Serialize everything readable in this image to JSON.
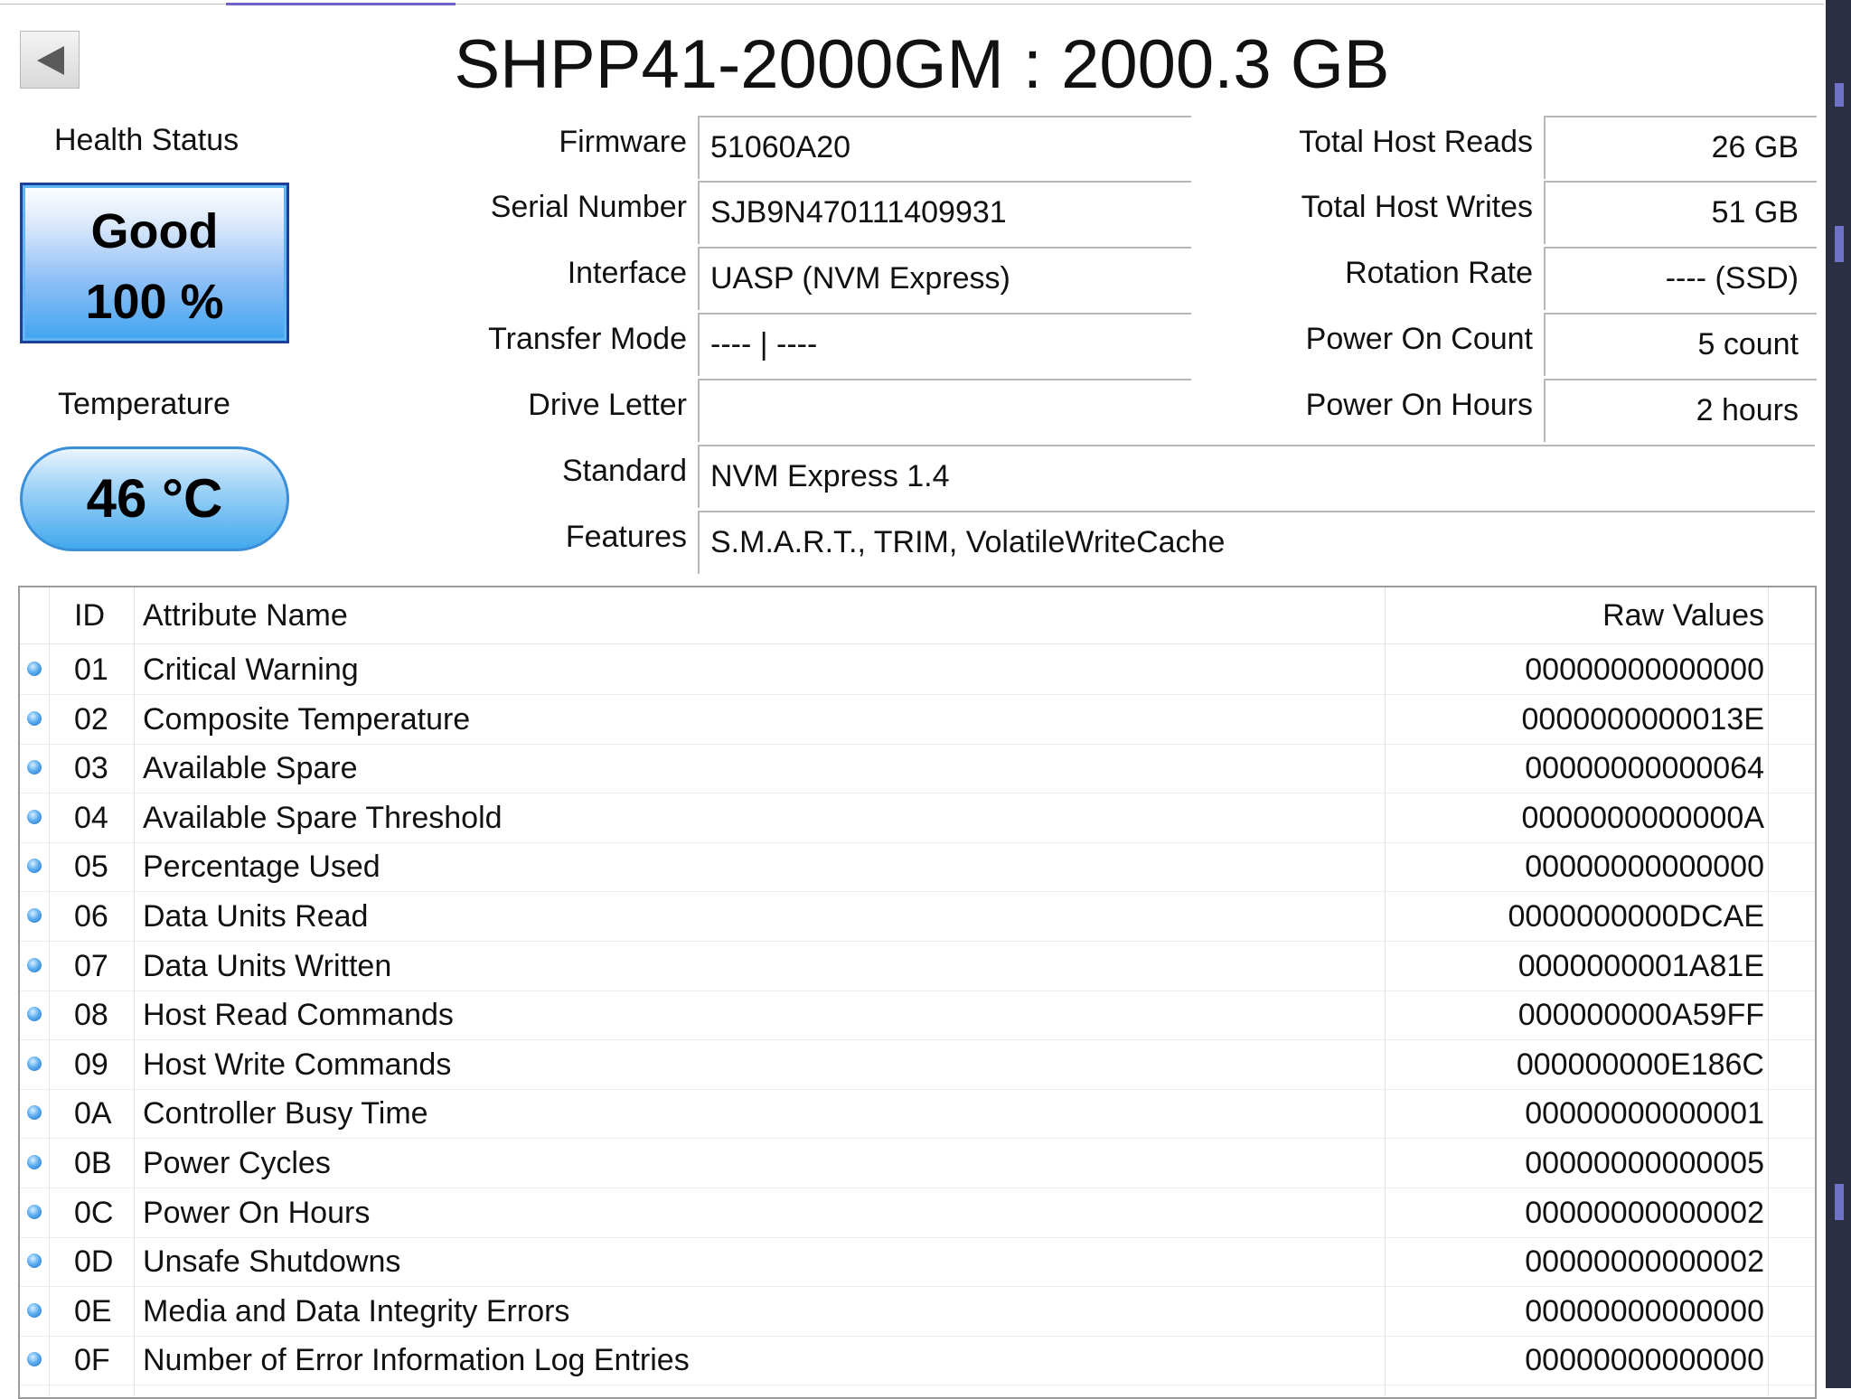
{
  "header": {
    "title": "SHPP41-2000GM : 2000.3 GB"
  },
  "health": {
    "label": "Health Status",
    "status": "Good",
    "percent": "100 %"
  },
  "temperature": {
    "label": "Temperature",
    "value": "46 °C"
  },
  "info_left": [
    {
      "label": "Firmware",
      "value": "51060A20"
    },
    {
      "label": "Serial Number",
      "value": "SJB9N470111409931"
    },
    {
      "label": "Interface",
      "value": "UASP (NVM Express)"
    },
    {
      "label": "Transfer Mode",
      "value": "---- | ----"
    },
    {
      "label": "Drive Letter",
      "value": ""
    },
    {
      "label": "Standard",
      "value": "NVM Express 1.4"
    },
    {
      "label": "Features",
      "value": "S.M.A.R.T., TRIM, VolatileWriteCache"
    }
  ],
  "info_right": [
    {
      "label": "Total Host Reads",
      "value": "26 GB"
    },
    {
      "label": "Total Host Writes",
      "value": "51 GB"
    },
    {
      "label": "Rotation Rate",
      "value": "---- (SSD)"
    },
    {
      "label": "Power On Count",
      "value": "5 count"
    },
    {
      "label": "Power On Hours",
      "value": "2 hours"
    }
  ],
  "smart": {
    "columns": {
      "id": "ID",
      "name": "Attribute Name",
      "raw": "Raw Values"
    },
    "rows": [
      {
        "id": "01",
        "name": "Critical Warning",
        "raw": "00000000000000"
      },
      {
        "id": "02",
        "name": "Composite Temperature",
        "raw": "0000000000013E"
      },
      {
        "id": "03",
        "name": "Available Spare",
        "raw": "00000000000064"
      },
      {
        "id": "04",
        "name": "Available Spare Threshold",
        "raw": "0000000000000A"
      },
      {
        "id": "05",
        "name": "Percentage Used",
        "raw": "00000000000000"
      },
      {
        "id": "06",
        "name": "Data Units Read",
        "raw": "0000000000DCAE"
      },
      {
        "id": "07",
        "name": "Data Units Written",
        "raw": "0000000001A81E"
      },
      {
        "id": "08",
        "name": "Host Read Commands",
        "raw": "000000000A59FF"
      },
      {
        "id": "09",
        "name": "Host Write Commands",
        "raw": "000000000E186C"
      },
      {
        "id": "0A",
        "name": "Controller Busy Time",
        "raw": "00000000000001"
      },
      {
        "id": "0B",
        "name": "Power Cycles",
        "raw": "00000000000005"
      },
      {
        "id": "0C",
        "name": "Power On Hours",
        "raw": "00000000000002"
      },
      {
        "id": "0D",
        "name": "Unsafe Shutdowns",
        "raw": "00000000000002"
      },
      {
        "id": "0E",
        "name": "Media and Data Integrity Errors",
        "raw": "00000000000000"
      },
      {
        "id": "0F",
        "name": "Number of Error Information Log Entries",
        "raw": "00000000000000"
      }
    ]
  },
  "icons": {
    "back": "back-arrow-icon",
    "status_dot": "status-dot-icon"
  },
  "colors": {
    "health_border": "#1c3f9c",
    "health_fill": "#41a4f0",
    "temp_fill": "#42a9ec",
    "tab_accent": "#6d63c8",
    "status_dot": "#1a6ec8"
  }
}
